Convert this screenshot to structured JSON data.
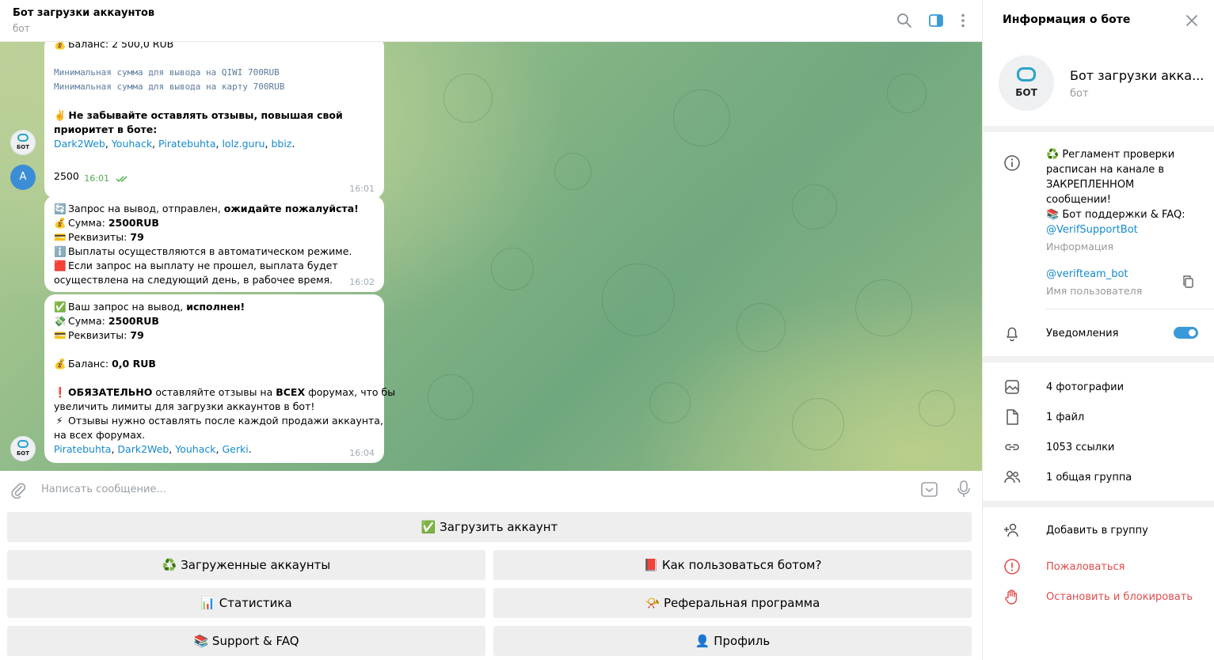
{
  "header": {
    "title": "Бот загрузки аккаунтов",
    "subtitle": "бот"
  },
  "messages": {
    "m1": {
      "balance": "Баланс: 2 500,0 RUB",
      "min_qiwi": "Минимальная сумма для вывода на QIWI 700RUB",
      "min_card": "Минимальная сумма для вывода на карту 700RUB",
      "reviews_1": "Не забывайте оставлять отзывы, повышая свой",
      "reviews_2": "приоритет в боте:",
      "links": [
        "Dark2Web",
        "Youhack",
        "Piratebuhta",
        "lolz.guru",
        "bbiz"
      ],
      "time": "16:01",
      "avatar": "БОТ"
    },
    "m2": {
      "text": "2500",
      "time": "16:01",
      "avatar": "A"
    },
    "m3": {
      "line1_a": "Запрос на вывод,  отправлен, ",
      "line1_b": "ожидайте пожалуйста!",
      "sum_label": "Сумма: ",
      "sum_value": "2500RUB",
      "req_label": "Реквизиты: ",
      "req_value": "79",
      "auto": "Выплаты осуществляются в автоматическом режиме.",
      "fail_1": "Если запрос на выплату не прошел, выплата будет",
      "fail_2": "осуществлена на следующий день, в рабочее время.",
      "time": "16:02"
    },
    "m4": {
      "done_a": "Ваш запрос на вывод, ",
      "done_b": "исполнен!",
      "sum_label": "Сумма: ",
      "sum_value": "2500RUB",
      "req_label": "Реквизиты: ",
      "req_value": "79",
      "balance_label": "Баланс: ",
      "balance_value": "0,0 RUB",
      "must_a": "ОБЯЗАТЕЛЬНО",
      "must_b": " оставляйте отзывы на ",
      "must_c": "ВСЕХ",
      "must_d": " форумах, что бы",
      "must_2": "увеличить лимиты для загрузки аккаунтов в бот!",
      "rev_1": "Отзывы нужно оставлять после каждой продажи аккаунта,",
      "rev_2": "на всех форумах.",
      "links": [
        "Piratebuhta",
        "Dark2Web",
        "Youhack",
        "Gerki"
      ],
      "time": "16:04",
      "avatar": "БОТ"
    }
  },
  "composer": {
    "placeholder": "Написать сообщение..."
  },
  "keyboard": {
    "upload": "✅ Загрузить аккаунт",
    "uploaded": "♻️ Загруженные аккаунты",
    "howto": "📕 Как пользоваться ботом?",
    "stats": "📊 Статистика",
    "referral": "📯 Реферальная программа",
    "support": "📚 Support & FAQ",
    "profile": "👤 Профиль"
  },
  "right_panel": {
    "title": "Информация о боте",
    "bot_name": "Бот загрузки акка...",
    "bot_sub": "бот",
    "avatar_text": "БОТ",
    "info_lines": [
      "♻️ Регламент проверки",
      "расписан на канале в",
      "ЗАКРЕПЛЕННОМ",
      "сообщении!",
      "📚 Бот поддержки & FAQ:"
    ],
    "support_link": "@VerifSupportBot",
    "info_label": "Информация",
    "username": "@verifteam_bot",
    "username_label": "Имя пользователя",
    "notifications": "Уведомления",
    "notifications_on": true,
    "media": {
      "photos": "4 фотографии",
      "files": "1 файл",
      "links": "1053 ссылки",
      "groups": "1 общая группа"
    },
    "add_to_group": "Добавить в группу",
    "report": "Пожаловаться",
    "block": "Остановить и блокировать"
  },
  "colors": {
    "accent": "#168acd",
    "danger": "#e04b4b",
    "toggle": "#3a9ad9"
  }
}
